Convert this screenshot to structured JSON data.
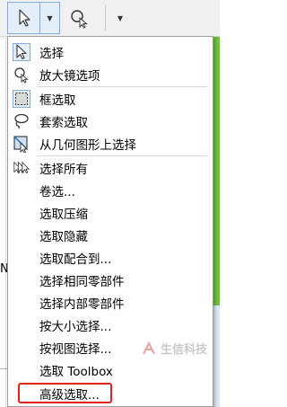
{
  "toolbar": {
    "select_icon": "cursor-arrow-icon",
    "zoom_icon": "zoom-select-icon"
  },
  "menu": {
    "items": [
      {
        "label": "选择",
        "icon": "cursor-arrow-icon"
      },
      {
        "label": "放大镜选项",
        "icon": "magnifier-icon"
      },
      {
        "label": "框选取",
        "icon": "box-select-icon"
      },
      {
        "label": "套索选取",
        "icon": "lasso-icon"
      },
      {
        "label": "从几何图形上选择",
        "icon": "geometry-select-icon"
      },
      {
        "label": "选择所有",
        "icon": "select-all-icon"
      },
      {
        "label": "卷选..."
      },
      {
        "label": "选取压缩"
      },
      {
        "label": "选取隐藏"
      },
      {
        "label": "选取配合到..."
      },
      {
        "label": "选择相同零部件"
      },
      {
        "label": "选择内部零部件"
      },
      {
        "label": "按大小选择..."
      },
      {
        "label": "按视图选择..."
      },
      {
        "label": "选取 Toolbox"
      },
      {
        "label": "高级选取..."
      }
    ]
  },
  "background": {
    "fragment_text": "N"
  },
  "watermark": {
    "text": "生信科技"
  },
  "colors": {
    "highlight": "#e2231a",
    "toolbar_active": "#e4eefa",
    "green_edge": "#6fbf3f"
  }
}
